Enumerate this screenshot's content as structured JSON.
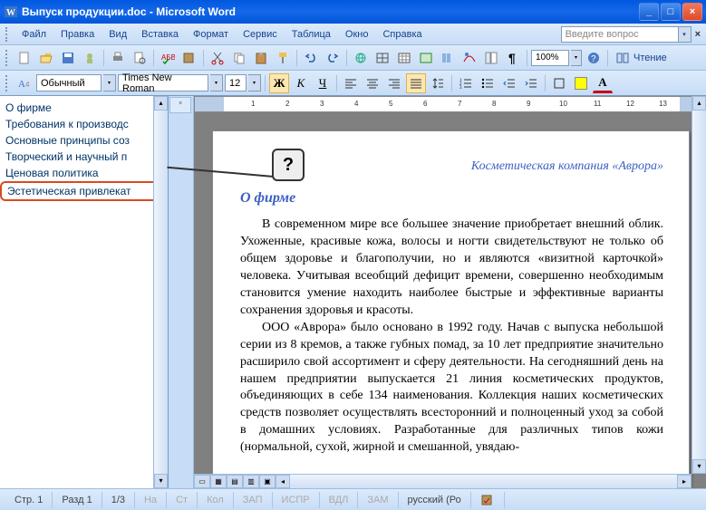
{
  "window": {
    "title": "Выпуск продукции.doc - Microsoft Word"
  },
  "menu": {
    "file": "Файл",
    "edit": "Правка",
    "view": "Вид",
    "insert": "Вставка",
    "format": "Формат",
    "service": "Сервис",
    "table": "Таблица",
    "window": "Окно",
    "help": "Справка",
    "help_placeholder": "Введите вопрос"
  },
  "toolbar": {
    "zoom": "100%",
    "reading_label": "Чтение"
  },
  "format": {
    "style": "Обычный",
    "font": "Times New Roman",
    "size": "12",
    "bold_label": "Ж",
    "italic_label": "К",
    "underline_label": "Ч",
    "font_a": "A"
  },
  "outline": {
    "items": [
      "О фирме",
      "Требования к производс",
      "Основные принципы соз",
      "Творческий и научный п",
      "Ценовая политика",
      "Эстетическая привлекат"
    ]
  },
  "callout": {
    "label": "?"
  },
  "ruler": {
    "ticks": [
      "1",
      "2",
      "3",
      "4",
      "5",
      "6",
      "7",
      "8",
      "9",
      "10",
      "11",
      "12",
      "13"
    ]
  },
  "doc": {
    "company": "Косметическая компания «Аврора»",
    "heading": "О фирме",
    "p1": "В современном мире все большее значение приобретает внешний облик. Ухоженные, красивые кожа, волосы и ногти свидетельствуют не только об общем здоровье и благополучии, но и являются «визитной кар­точкой» человека. Учитывая всеобщий дефицит времени, совершенно не­обходимым становится умение находить наиболее быстрые и эффектив­ные варианты сохранения здоровья и красоты.",
    "p2": "ООО «Аврора» было основано в 1992 году. Начав с выпуска не­большой серии из 8 кремов, а также губных помад, за 10 лет предприятие значительно расширило свой ассортимент и сферу деятельности. На сего­дняшний день на нашем предприятии выпускается 21 линия косметиче­ских продуктов, объединяющих в себе 134 наименования. Коллекция на­ших косметических средств позволяет осуществлять всесторонний и пол­ноценный уход за собой в домашних условиях. Разработанные для раз­личных типов кожи (нормальной, сухой, жирной и смешанной, увядаю-"
  },
  "status": {
    "page": "Стр. 1",
    "section": "Разд 1",
    "pages": "1/3",
    "at": "На",
    "row": "Ст",
    "col": "Кол",
    "rec": "ЗАП",
    "fix": "ИСПР",
    "ext": "ВДЛ",
    "ovr": "ЗАМ",
    "lang": "русский (Ро"
  }
}
